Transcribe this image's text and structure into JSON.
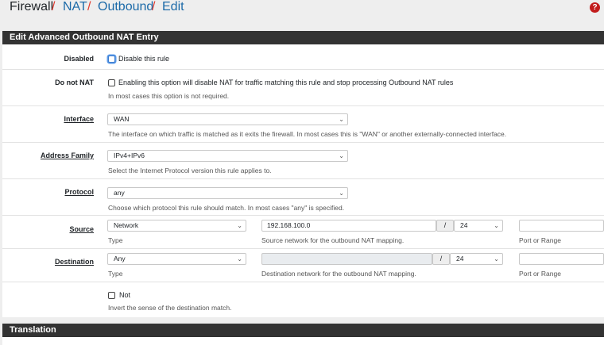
{
  "breadcrumb": {
    "items": [
      "Firewall",
      "NAT",
      "Outbound",
      "Edit"
    ],
    "separator": "/"
  },
  "help_icon": "question-circle-icon",
  "panel": {
    "title": "Edit Advanced Outbound NAT Entry",
    "disabled": {
      "label": "Disabled",
      "checkbox_text": "Disable this rule",
      "checked": false
    },
    "do_not_nat": {
      "label": "Do not NAT",
      "checkbox_text": "Enabling this option will disable NAT for traffic matching this rule and stop processing Outbound NAT rules",
      "help": "In most cases this option is not required.",
      "checked": false
    },
    "interface": {
      "label": "Interface",
      "value": "WAN",
      "help": "The interface on which traffic is matched as it exits the firewall. In most cases this is \"WAN\" or another externally-connected interface."
    },
    "address_family": {
      "label": "Address Family",
      "value": "IPv4+IPv6",
      "help": "Select the Internet Protocol version this rule applies to."
    },
    "protocol": {
      "label": "Protocol",
      "value": "any",
      "help": "Choose which protocol this rule should match. In most cases \"any\" is specified."
    },
    "source": {
      "label": "Source",
      "type_value": "Network",
      "type_help": "Type",
      "network_value": "192.168.100.0",
      "network_help": "Source network for the outbound NAT mapping.",
      "slash": "/",
      "mask_value": "24",
      "port_value": "",
      "port_help": "Port or Range"
    },
    "destination": {
      "label": "Destination",
      "type_value": "Any",
      "type_help": "Type",
      "network_value": "",
      "network_help": "Destination network for the outbound NAT mapping.",
      "slash": "/",
      "mask_value": "24",
      "port_value": "",
      "port_help": "Port or Range"
    },
    "not": {
      "checkbox_text": "Not",
      "help": "Invert the sense of the destination match.",
      "checked": false
    }
  },
  "translation_panel": {
    "title": "Translation"
  },
  "colors": {
    "panel_header": "#333333",
    "link": "#1c6aa8",
    "separator": "#e23b30",
    "help_icon": "#c21d1d"
  }
}
